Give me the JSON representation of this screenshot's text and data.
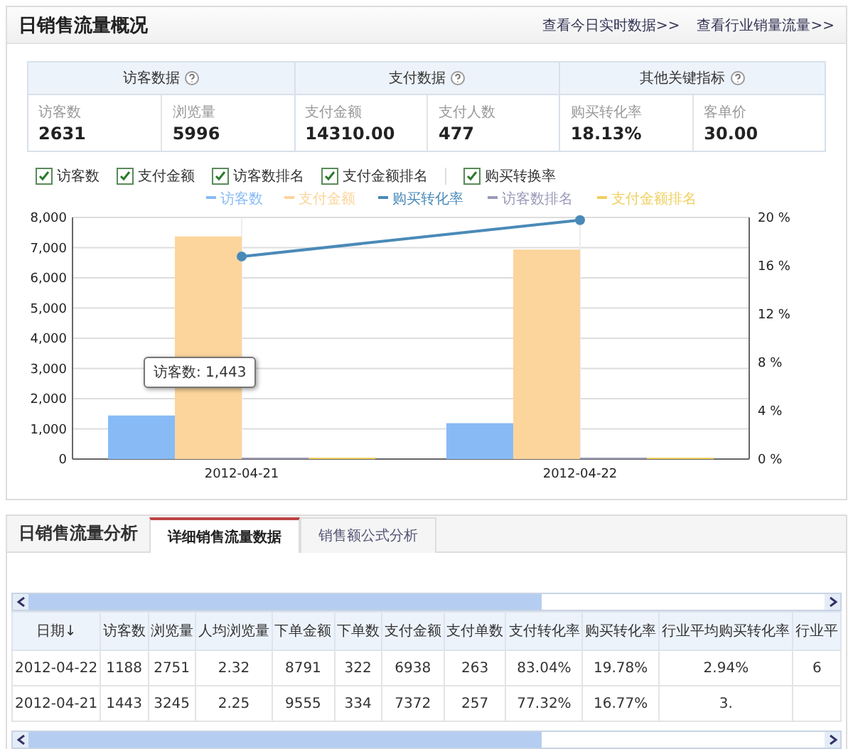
{
  "overview": {
    "title": "日销售流量概况",
    "links": [
      "查看今日实时数据>>",
      "查看行业销量流量>>"
    ],
    "groups": [
      {
        "title": "访客数据",
        "metrics": [
          {
            "label": "访客数",
            "value": "2631"
          },
          {
            "label": "浏览量",
            "value": "5996"
          }
        ]
      },
      {
        "title": "支付数据",
        "metrics": [
          {
            "label": "支付金额",
            "value": "14310.00"
          },
          {
            "label": "支付人数",
            "value": "477"
          }
        ]
      },
      {
        "title": "其他关键指标",
        "metrics": [
          {
            "label": "购买转化率",
            "value": "18.13%"
          },
          {
            "label": "客单价",
            "value": "30.00"
          }
        ]
      }
    ],
    "toggle_groups": [
      {
        "items": [
          {
            "label": "访客数",
            "checked": true
          },
          {
            "label": "支付金额",
            "checked": true
          },
          {
            "label": "访客数排名",
            "checked": true
          },
          {
            "label": "支付金额排名",
            "checked": true
          }
        ]
      },
      {
        "items": [
          {
            "label": "购买转换率",
            "checked": true
          }
        ]
      }
    ],
    "chart_data": {
      "type": "bar",
      "categories": [
        "2012-04-21",
        "2012-04-22"
      ],
      "ylim": [
        0,
        8000
      ],
      "yticks": [
        {
          "value": 0,
          "label": "0"
        },
        {
          "value": 1000,
          "label": "1,000"
        },
        {
          "value": 2000,
          "label": "2,000"
        },
        {
          "value": 3000,
          "label": "3,000"
        },
        {
          "value": 4000,
          "label": "4,000"
        },
        {
          "value": 5000,
          "label": "5,000"
        },
        {
          "value": 6000,
          "label": "6,000"
        },
        {
          "value": 7000,
          "label": "7,000"
        },
        {
          "value": 8000,
          "label": "8,000"
        }
      ],
      "grid": true,
      "legend": true,
      "series": [
        {
          "name": "访客数",
          "color": "#88bbf5",
          "values": [
            1443,
            1188
          ]
        },
        {
          "name": "支付金额",
          "color": "#fcd59c",
          "values": [
            7372,
            6938
          ]
        },
        {
          "name": "访客数排名",
          "color": "#9a9ab8",
          "values": [
            0,
            0
          ]
        },
        {
          "name": "支付金额排名",
          "color": "#f0d060",
          "values": [
            0,
            0
          ]
        }
      ]
    },
    "rate_chart": {
      "chart_data": {
        "type": "line",
        "ylim": [
          0,
          20
        ],
        "yticks": [
          {
            "value": 0,
            "label": "0 %"
          },
          {
            "value": 4,
            "label": "4 %"
          },
          {
            "value": 8,
            "label": "8 %"
          },
          {
            "value": 12,
            "label": "12 %"
          },
          {
            "value": 16,
            "label": "16 %"
          },
          {
            "value": 20,
            "label": "20 %"
          }
        ],
        "series": [
          {
            "name": "购买转化率",
            "color": "#4a8ab8",
            "marker": true,
            "values": [
              16.77,
              19.78
            ]
          }
        ]
      }
    },
    "tooltip": "访客数: 1,443"
  },
  "analysis": {
    "title": "日销售流量分析",
    "tabs": [
      {
        "label": "详细销售流量数据",
        "selected": true
      },
      {
        "label": "销售额公式分析",
        "selected": false
      }
    ],
    "table": {
      "columns": [
        "日期↓",
        "访客数",
        "浏览量",
        "人均浏览量",
        "下单金额",
        "下单数",
        "支付金额",
        "支付单数",
        "支付转化率",
        "购买转化率",
        "行业平均购买转化率",
        "行业平"
      ],
      "rows": [
        [
          "2012-04-22",
          "1188",
          "2751",
          "2.32",
          "8791",
          "322",
          "6938",
          "263",
          "83.04%",
          "19.78%",
          "2.94%",
          "6"
        ],
        [
          "2012-04-21",
          "1443",
          "3245",
          "2.25",
          "9555",
          "334",
          "7372",
          "257",
          "77.32%",
          "16.77%",
          "3."
        ]
      ]
    }
  }
}
